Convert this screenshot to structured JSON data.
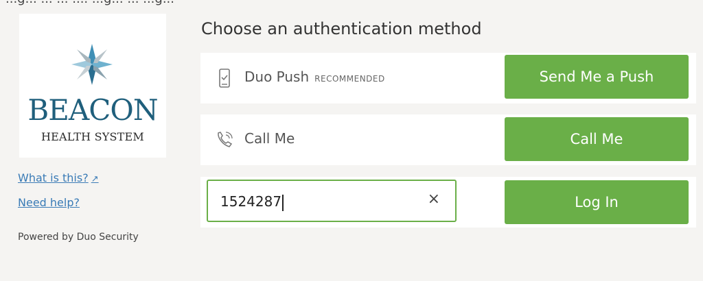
{
  "top_partial_text": "...g... ... ... .... ...g... ... ...g...",
  "logo": {
    "name": "BEACON",
    "tagline": "HEALTH SYSTEM"
  },
  "sidebar": {
    "what_is_this": "What is this?",
    "need_help": "Need help?",
    "powered_by": "Powered by Duo Security"
  },
  "main": {
    "title": "Choose an authentication method",
    "methods": [
      {
        "label": "Duo Push",
        "badge": "RECOMMENDED",
        "button": "Send Me a Push",
        "icon": "phone-icon"
      },
      {
        "label": "Call Me",
        "button": "Call Me",
        "icon": "phone-call-icon"
      },
      {
        "button": "Log In",
        "input_value": "1524287",
        "clear": "×"
      }
    ]
  },
  "colors": {
    "accent_green": "#6aaf48",
    "link_blue": "#3a7bb6",
    "logo_blue": "#1f5f7c",
    "background": "#f5f4f2"
  }
}
